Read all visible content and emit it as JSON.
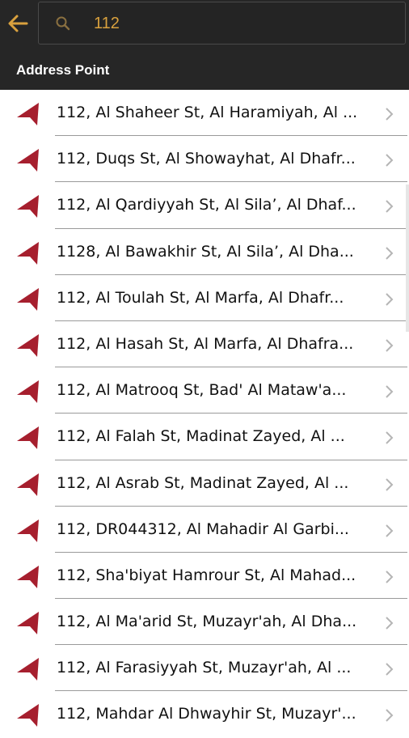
{
  "header": {
    "back_icon": "back-arrow-icon",
    "search_icon": "search-icon",
    "search_value": "112",
    "section_title": "Address Point",
    "colors": {
      "bar": "#262626",
      "accent": "#d9a13e",
      "pin": "#a61f2e"
    }
  },
  "results": {
    "row_icon": "location-pin-icon",
    "chevron_icon": "chevron-right-icon",
    "items": [
      {
        "label": "112, Al Shaheer St, Al Haramiyah, Al ..."
      },
      {
        "label": "112, Duqs St, Al Showayhat, Al Dhafr..."
      },
      {
        "label": "112, Al Qardiyyah St, Al Sila’, Al Dhaf..."
      },
      {
        "label": "1128, Al Bawakhir St, Al Sila’, Al Dha..."
      },
      {
        "label": "112, Al Toulah St, Al Marfa, Al Dhafr..."
      },
      {
        "label": "112, Al Hasah St, Al Marfa, Al Dhafra..."
      },
      {
        "label": "112, Al Matrooq St, Bad' Al Mataw'a..."
      },
      {
        "label": "112, Al Falah St, Madinat Zayed, Al ..."
      },
      {
        "label": "112, Al Asrab St, Madinat Zayed, Al ..."
      },
      {
        "label": "112, DR044312, Al Mahadir Al Garbi..."
      },
      {
        "label": "112, Sha'biyat Hamrour St, Al Mahad..."
      },
      {
        "label": "112, Al Ma'arid St, Muzayr'ah, Al Dha..."
      },
      {
        "label": "112, Al Farasiyyah St, Muzayr'ah, Al ..."
      },
      {
        "label": "112, Mahdar Al Dhwayhir St, Muzayr'..."
      }
    ]
  }
}
